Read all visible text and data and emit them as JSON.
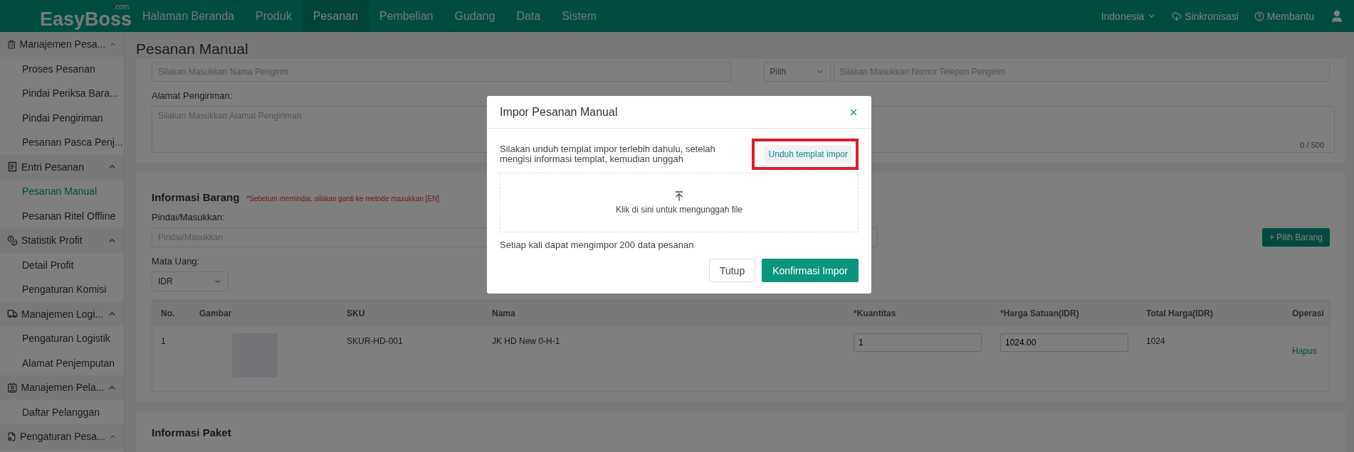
{
  "header": {
    "logo": "EasyBoss",
    "logo_suffix": ".com",
    "nav": [
      {
        "label": "Halaman Beranda",
        "selected": false
      },
      {
        "label": "Produk",
        "selected": false
      },
      {
        "label": "Pesanan",
        "selected": true
      },
      {
        "label": "Pembelian",
        "selected": false
      },
      {
        "label": "Gudang",
        "selected": false
      },
      {
        "label": "Data",
        "selected": false
      },
      {
        "label": "Sistem",
        "selected": false
      }
    ],
    "language": "Indonesia",
    "sync": "Sinkronisasi",
    "help": "Membantu"
  },
  "sidebar": {
    "groups": [
      {
        "label": "Manajemen Pesa...",
        "expanded": true,
        "items": [
          {
            "label": "Proses Pesanan",
            "selected": false
          },
          {
            "label": "Pindai Periksa Bara...",
            "selected": false
          },
          {
            "label": "Pindai Pengiriman",
            "selected": false
          },
          {
            "label": "Pesanan Pasca Penj...",
            "selected": false
          }
        ]
      },
      {
        "label": "Entri Pesanan",
        "expanded": true,
        "items": [
          {
            "label": "Pesanan Manual",
            "selected": true
          },
          {
            "label": "Pesanan Ritel Offline",
            "selected": false
          }
        ]
      },
      {
        "label": "Statistik Profit",
        "expanded": true,
        "items": [
          {
            "label": "Detail Profit",
            "selected": false
          },
          {
            "label": "Pengaturan Komisi",
            "selected": false
          }
        ]
      },
      {
        "label": "Manajemen Logi...",
        "expanded": true,
        "items": [
          {
            "label": "Pengaturan Logistik",
            "selected": false
          },
          {
            "label": "Alamat Penjemputan",
            "selected": false
          }
        ]
      },
      {
        "label": "Manajemen Pela...",
        "expanded": true,
        "items": [
          {
            "label": "Daftar Pelanggan",
            "selected": false
          }
        ]
      },
      {
        "label": "Pengaturan Pesa...",
        "expanded": true
      }
    ]
  },
  "page_title": "Pesanan Manual",
  "sender": {
    "name_placeholder": "Silakan Masukkan Nama Pengirim",
    "phone_prefix": "Pilih",
    "phone_placeholder": "Silakan Masukkan Nomor Telepon Pengirim",
    "address_label": "Alamat Pengiriman:",
    "address_placeholder": "Silakan Masukkan Alamat Pengiriman",
    "counter": "0 / 500"
  },
  "items_section": {
    "title": "Informasi Barang",
    "note": "*Sebelum memindai, silakan ganti ke metode masukkan [EN]",
    "scan_label": "Pindai/Masukkan:",
    "scan_placeholder": "Pindai/Masukkan",
    "add_button": "+ Pilih Barang",
    "currency_label": "Mata Uang:",
    "currency": "IDR",
    "columns": [
      {
        "label": "No."
      },
      {
        "label": "Gambar"
      },
      {
        "label": "SKU"
      },
      {
        "label": "Nama"
      },
      {
        "label": "Kuantitas",
        "required_mark": "*"
      },
      {
        "label": "Harga Satuan(IDR)",
        "required_mark": "*"
      },
      {
        "label": "Total Harga(IDR)"
      },
      {
        "label": "Operasi"
      }
    ],
    "rows": [
      {
        "no": "1",
        "sku": "SKUR-HD-001",
        "name": "JK HD New 0-H-1",
        "quantity": "1",
        "price": "1024.00",
        "total": "1024",
        "action": "Hapus"
      }
    ]
  },
  "package_section": {
    "title": "Informasi Paket"
  },
  "dialog": {
    "title": "Impor Pesanan Manual",
    "instruction": "Silakan unduh templat impor terlebih dahulu, setelah mengisi informasi templat, kemudian unggah",
    "template_button": "Unduh templat impor",
    "upload_text": "Klik di sini untuk mengunggah file",
    "limit_note": "Setiap kali dapat mengimpor 200 data pesanan",
    "cancel_button": "Tutup",
    "confirm_button": "Konfirmasi Impor"
  }
}
